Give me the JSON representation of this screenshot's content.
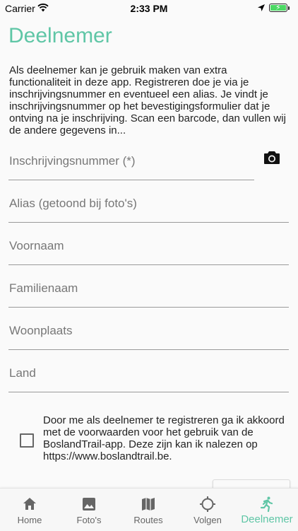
{
  "status_bar": {
    "carrier": "Carrier",
    "time": "2:33 PM"
  },
  "page": {
    "title": "Deelnemer",
    "intro": "Als deelnemer kan je gebruik maken van extra functionaliteit in deze app. Registreren doe je via je inschrijvingsnummer en eventueel een alias. Je vindt je inschrijvingsnummer op het bevestigingsformulier dat je ontving na je inschrijving. Scan een barcode, dan vullen wij de andere gegevens in..."
  },
  "form": {
    "fields": [
      {
        "placeholder": "Inschrijvingsnummer (*)",
        "value": ""
      },
      {
        "placeholder": "Alias (getoond bij foto's)",
        "value": ""
      },
      {
        "placeholder": "Voornaam",
        "value": ""
      },
      {
        "placeholder": "Familienaam",
        "value": ""
      },
      {
        "placeholder": "Woonplaats",
        "value": ""
      },
      {
        "placeholder": "Land",
        "value": ""
      }
    ],
    "consent": {
      "checked": false,
      "text": "Door me als deelnemer te registreren ga ik akkoord met de voorwaarden voor het gebruik van de BoslandTrail-app. Deze zijn kan ik nalezen op https://www.boslandtrail.be."
    }
  },
  "tabs": [
    {
      "label": "Home",
      "icon": "home-icon"
    },
    {
      "label": "Foto's",
      "icon": "photo-icon"
    },
    {
      "label": "Routes",
      "icon": "map-icon"
    },
    {
      "label": "Volgen",
      "icon": "crosshair-icon"
    },
    {
      "label": "Deelnemer",
      "icon": "runner-icon",
      "active": true
    }
  ],
  "colors": {
    "accent": "#5fc6a6",
    "background": "#fafafa",
    "tab_inactive": "#666666"
  }
}
